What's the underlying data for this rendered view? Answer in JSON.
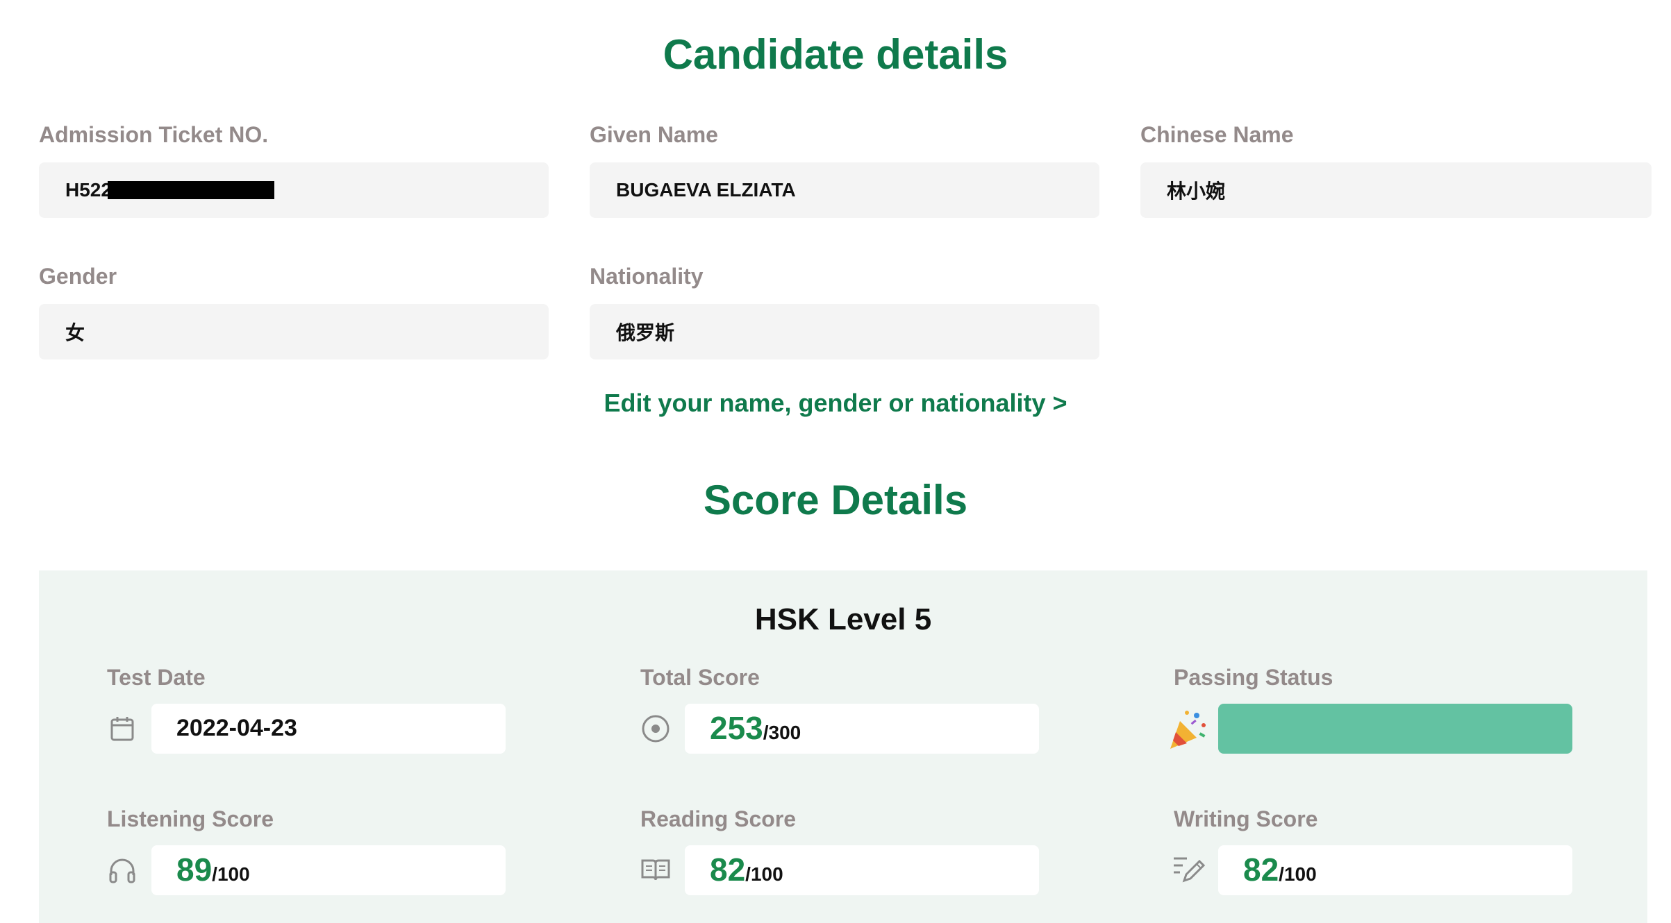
{
  "candidate": {
    "title": "Candidate details",
    "admission": {
      "label": "Admission Ticket NO.",
      "value": "H522"
    },
    "given_name": {
      "label": "Given Name",
      "value": "BUGAEVA ELZIATA"
    },
    "chinese_name": {
      "label": "Chinese Name",
      "value": "林小婉"
    },
    "gender": {
      "label": "Gender",
      "value": "女"
    },
    "nationality": {
      "label": "Nationality",
      "value": "俄罗斯"
    },
    "edit_link": "Edit your name, gender or nationality >"
  },
  "score": {
    "title": "Score Details",
    "level": "HSK Level 5",
    "test_date": {
      "label": "Test Date",
      "value": "2022-04-23",
      "icon": "calendar-icon"
    },
    "total": {
      "label": "Total Score",
      "value": "253",
      "max": "/300",
      "icon": "target-icon"
    },
    "passing": {
      "label": "Passing Status",
      "icon": "party-popper-icon"
    },
    "listening": {
      "label": "Listening Score",
      "value": "89",
      "max": "/100",
      "icon": "headphones-icon"
    },
    "reading": {
      "label": "Reading Score",
      "value": "82",
      "max": "/100",
      "icon": "book-icon"
    },
    "writing": {
      "label": "Writing Score",
      "value": "82",
      "max": "/100",
      "icon": "pen-icon"
    }
  },
  "colors": {
    "accent": "#0f7a4c",
    "score_green": "#1a8a4c",
    "label_gray": "#938a8a",
    "panel_bg": "#eff5f2",
    "pass_bar": "#63c2a2"
  }
}
